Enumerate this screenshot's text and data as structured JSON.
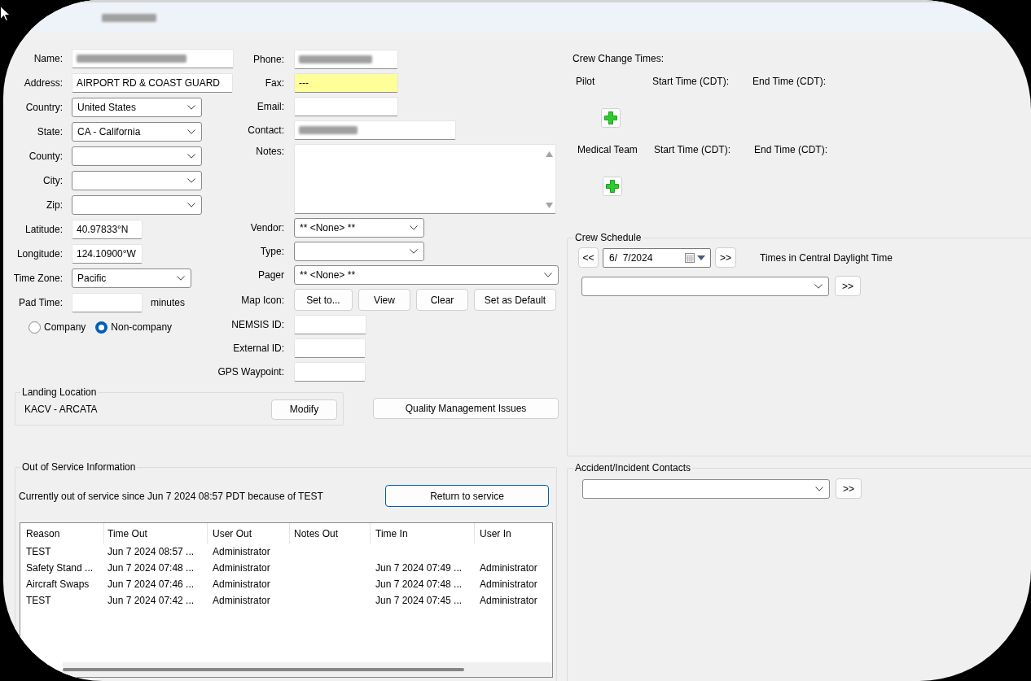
{
  "window": {
    "title_redacted": true
  },
  "left_form": {
    "fields": [
      {
        "kind": "text",
        "label": "Name:",
        "redacted": true
      },
      {
        "kind": "text",
        "label": "Address:",
        "value": "AIRPORT RD & COAST GUARD"
      },
      {
        "kind": "dropdown",
        "label": "Country:",
        "value": "United States"
      },
      {
        "kind": "dropdown",
        "label": "State:",
        "value": "CA - California"
      },
      {
        "kind": "dropdown",
        "label": "County:"
      },
      {
        "kind": "dropdown",
        "label": "City:"
      },
      {
        "kind": "dropdown",
        "label": "Zip:"
      },
      {
        "kind": "text",
        "label": "Latitude:",
        "value": "40.97833°N"
      },
      {
        "kind": "text",
        "label": "Longitude:",
        "value": "124.10900°W"
      },
      {
        "kind": "dropdown",
        "label": "Time Zone:",
        "value": "Pacific"
      },
      {
        "kind": "text",
        "label": "Pad Time:",
        "suffix": "minutes"
      }
    ],
    "radios": [
      {
        "label": "Company",
        "selected": false
      },
      {
        "label": "Non-company",
        "selected": true
      }
    ]
  },
  "middle_form": {
    "fields": [
      {
        "kind": "text",
        "label": "Phone:",
        "redacted": true
      },
      {
        "kind": "text",
        "label": "Fax:",
        "value": "---",
        "highlighted": true
      },
      {
        "kind": "text",
        "label": "Email:"
      },
      {
        "kind": "text",
        "label": "Contact:",
        "redacted": true
      },
      {
        "kind": "textarea",
        "label": "Notes:"
      },
      {
        "kind": "dropdown",
        "label": "Vendor:",
        "value": "** <None> **"
      },
      {
        "kind": "dropdown",
        "label": "Type:"
      },
      {
        "kind": "dropdown",
        "label": "Pager",
        "value": "** <None> **"
      },
      {
        "kind": "buttons",
        "label": "Map Icon:",
        "buttons": [
          "Set to...",
          "View",
          "Clear",
          "Set as Default"
        ]
      },
      {
        "kind": "text",
        "label": "NEMSIS ID:"
      },
      {
        "kind": "text",
        "label": "External ID:"
      },
      {
        "kind": "text",
        "label": "GPS Waypoint:"
      }
    ]
  },
  "landing_location": {
    "title": "Landing Location",
    "value": "KACV - ARCATA",
    "button": "Modify"
  },
  "quality_button": "Quality Management Issues",
  "out_of_service": {
    "title": "Out of Service Information",
    "status": "Currently out of service since Jun 7 2024 08:57 PDT because of TEST",
    "button": {
      "label": "Return to service",
      "default": true
    },
    "table": {
      "columns": [
        "Reason",
        "Time Out",
        "User Out",
        "Notes Out",
        "Time In",
        "User In"
      ],
      "rows": [
        {
          "reason": "TEST",
          "time_out": "Jun 7 2024 08:57 ...",
          "user_out": "Administrator"
        },
        {
          "reason": "Safety Stand ...",
          "time_out": "Jun 7 2024 07:48 ...",
          "user_out": "Administrator",
          "time_in": "Jun 7 2024 07:49 ...",
          "user_in": "Administrator"
        },
        {
          "reason": "Aircraft Swaps",
          "time_out": "Jun 7 2024 07:46 ...",
          "user_out": "Administrator",
          "time_in": "Jun 7 2024 07:48 ...",
          "user_in": "Administrator"
        },
        {
          "reason": "TEST",
          "time_out": "Jun 7 2024 07:42 ...",
          "user_out": "Administrator",
          "time_in": "Jun 7 2024 07:45 ...",
          "user_in": "Administrator"
        }
      ]
    }
  },
  "crew_change_times": {
    "title": "Crew Change Times:",
    "groups": [
      {
        "label": "Pilot",
        "start_label": "Start Time (CDT):",
        "end_label": "End Time (CDT):"
      },
      {
        "label": "Medical Team",
        "start_label": "Start Time (CDT):",
        "end_label": "End Time (CDT):"
      }
    ]
  },
  "crew_schedule": {
    "title": "Crew Schedule",
    "prev_button": "<<",
    "date": "6/  7/2024",
    "next_button": ">>",
    "note": "Times in Central Daylight Time",
    "go_button": ">>"
  },
  "accident_contacts": {
    "title": "Accident/Incident Contacts",
    "go_button": ">>"
  }
}
